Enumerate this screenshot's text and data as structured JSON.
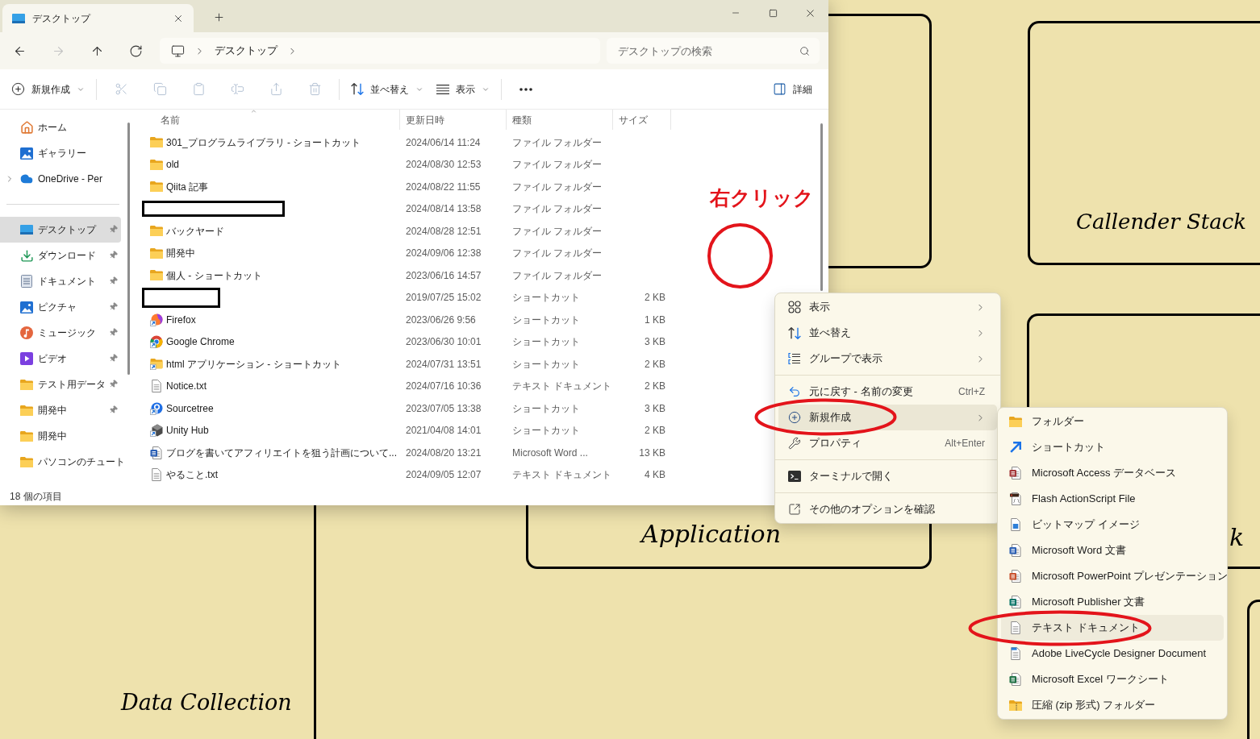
{
  "window": {
    "tab": {
      "title": "デスクトップ",
      "selected": true
    }
  },
  "navigation": {
    "buttons": [
      {
        "kind": "back",
        "disabled": false
      },
      {
        "kind": "forward",
        "disabled": true
      },
      {
        "kind": "up",
        "disabled": false
      },
      {
        "kind": "refresh",
        "disabled": false
      }
    ],
    "address": {
      "segments": [
        "デスクトップ"
      ]
    },
    "search": {
      "placeholder": "デスクトップの検索"
    }
  },
  "toolbar": {
    "groups": [
      {
        "items": [
          {
            "kind": "new",
            "label": "新規作成",
            "dropdown": true,
            "disabled": false
          }
        ]
      },
      {
        "items": [
          {
            "kind": "cut",
            "disabled": true
          },
          {
            "kind": "copy",
            "disabled": true
          },
          {
            "kind": "paste",
            "disabled": true
          },
          {
            "kind": "rename",
            "disabled": true
          },
          {
            "kind": "share",
            "disabled": true
          },
          {
            "kind": "delete",
            "disabled": true
          }
        ]
      },
      {
        "items": [
          {
            "kind": "sort",
            "label": "並べ替え",
            "dropdown": true,
            "disabled": false
          },
          {
            "kind": "view",
            "label": "表示",
            "dropdown": true,
            "disabled": false
          }
        ]
      },
      {
        "items": [
          {
            "kind": "more",
            "disabled": false
          }
        ]
      }
    ],
    "details": {
      "label": "詳細"
    }
  },
  "sidebar": {
    "items": [
      {
        "kind": "home",
        "label": "ホーム",
        "selected": false
      },
      {
        "kind": "gallery",
        "label": "ギャラリー",
        "selected": false
      },
      {
        "kind": "cloud",
        "label": "OneDrive - Per",
        "selected": false,
        "expanded": false
      }
    ],
    "quick_access": [
      {
        "kind": "desktop",
        "label": "デスクトップ",
        "selected": true,
        "pinned": true
      },
      {
        "kind": "download",
        "label": "ダウンロード",
        "selected": false,
        "pinned": true
      },
      {
        "kind": "documents",
        "label": "ドキュメント",
        "selected": false,
        "pinned": true
      },
      {
        "kind": "pictures",
        "label": "ピクチャ",
        "selected": false,
        "pinned": true
      },
      {
        "kind": "music",
        "label": "ミュージック",
        "selected": false,
        "pinned": true
      },
      {
        "kind": "video",
        "label": "ビデオ",
        "selected": false,
        "pinned": true
      },
      {
        "kind": "folder",
        "label": "テスト用データ",
        "selected": false,
        "pinned": true
      },
      {
        "kind": "folder",
        "label": "開発中",
        "selected": false,
        "pinned": true
      },
      {
        "kind": "folder",
        "label": "開発中",
        "selected": false,
        "pinned": false
      },
      {
        "kind": "folder",
        "label": "パソコンのチュート",
        "selected": false,
        "pinned": false
      }
    ]
  },
  "file_list": {
    "columns": [
      {
        "label": "名前",
        "sorted": true
      },
      {
        "label": "更新日時",
        "sorted": false
      },
      {
        "label": "種類",
        "sorted": false
      },
      {
        "label": "サイズ",
        "sorted": false
      }
    ],
    "rows": [
      {
        "kind": "folder",
        "name": "301_プログラムライブラリ - ショートカット",
        "modified": "2024/06/14 11:24",
        "type": "ファイル フォルダー"
      },
      {
        "kind": "folder",
        "name": "old",
        "modified": "2024/08/30 12:53",
        "type": "ファイル フォルダー"
      },
      {
        "kind": "folder",
        "name": "Qiita 記事",
        "modified": "2024/08/22 11:55",
        "type": "ファイル フォルダー"
      },
      {
        "kind": "redacted",
        "modified": "2024/08/14 13:58",
        "type": "ファイル フォルダー"
      },
      {
        "kind": "folder",
        "name": "バックヤード",
        "modified": "2024/08/28 12:51",
        "type": "ファイル フォルダー"
      },
      {
        "kind": "folder",
        "name": "開発中",
        "modified": "2024/09/06 12:38",
        "type": "ファイル フォルダー"
      },
      {
        "kind": "folder",
        "name": "個人 - ショートカット",
        "modified": "2023/06/16 14:57",
        "type": "ファイル フォルダー"
      },
      {
        "kind": "redacted",
        "modified": "2019/07/25 15:02",
        "type": "ショートカット",
        "size": "2 KB"
      },
      {
        "kind": "fox-app",
        "name": "Firefox",
        "modified": "2023/06/26 9:56",
        "type": "ショートカット",
        "size": "1 KB"
      },
      {
        "kind": "ring-app",
        "name": "Google Chrome",
        "modified": "2023/06/30 10:01",
        "type": "ショートカット",
        "size": "3 KB"
      },
      {
        "kind": "folder-shortcut",
        "name": "html アプリケーション - ショートカット",
        "modified": "2024/07/31 13:51",
        "type": "ショートカット",
        "size": "2 KB"
      },
      {
        "kind": "text-doc",
        "name": "Notice.txt",
        "modified": "2024/07/16 10:36",
        "type": "テキスト ドキュメント",
        "size": "2 KB"
      },
      {
        "kind": "swirl-app",
        "name": "Sourcetree",
        "modified": "2023/07/05 13:38",
        "type": "ショートカット",
        "size": "3 KB"
      },
      {
        "kind": "cube-app",
        "name": "Unity Hub",
        "modified": "2021/04/08 14:01",
        "type": "ショートカット",
        "size": "2 KB"
      },
      {
        "kind": "word-doc",
        "name": "ブログを書いてアフィリエイトを狙う計画について...",
        "modified": "2024/08/20 13:21",
        "type": "Microsoft Word ...",
        "size": "13 KB"
      },
      {
        "kind": "text-doc",
        "name": "やること.txt",
        "modified": "2024/09/05 12:07",
        "type": "テキスト ドキュメント",
        "size": "4 KB"
      }
    ]
  },
  "status_bar": {
    "text": "18 個の項目"
  },
  "click_annotation": {
    "label": "右クリック"
  },
  "context_menu": {
    "sections": [
      {
        "items": [
          {
            "kind": "view",
            "label": "表示",
            "submenu": true,
            "selected": false,
            "circled": false
          },
          {
            "kind": "sort",
            "label": "並べ替え",
            "submenu": true,
            "selected": false,
            "circled": false
          },
          {
            "kind": "group",
            "label": "グループで表示",
            "submenu": true,
            "selected": false,
            "circled": false
          }
        ]
      },
      {
        "items": [
          {
            "kind": "undo",
            "label": "元に戻す - 名前の変更",
            "shortcut": "Ctrl+Z",
            "submenu": false,
            "selected": false,
            "circled": false
          },
          {
            "kind": "new",
            "label": "新規作成",
            "submenu": true,
            "selected": true,
            "circled": true
          },
          {
            "kind": "properties",
            "label": "プロパティ",
            "shortcut": "Alt+Enter",
            "submenu": false,
            "selected": false,
            "circled": false
          }
        ]
      },
      {
        "items": [
          {
            "kind": "terminal",
            "label": "ターミナルで開く",
            "submenu": false,
            "selected": false,
            "circled": false
          }
        ]
      },
      {
        "items": [
          {
            "kind": "more-options",
            "label": "その他のオプションを確認",
            "submenu": false,
            "selected": false,
            "circled": false
          }
        ]
      }
    ]
  },
  "submenu": {
    "items": [
      {
        "kind": "folder",
        "label": "フォルダー",
        "selected": false,
        "circled": false
      },
      {
        "kind": "shortcut",
        "label": "ショートカット",
        "selected": false,
        "circled": false
      },
      {
        "kind": "db-doc",
        "label": "Microsoft Access データベース",
        "selected": false,
        "circled": false
      },
      {
        "kind": "script-doc",
        "label": "Flash ActionScript File",
        "selected": false,
        "circled": false
      },
      {
        "kind": "image-doc",
        "label": "ビットマップ イメージ",
        "selected": false,
        "circled": false
      },
      {
        "kind": "word-doc",
        "label": "Microsoft Word 文書",
        "selected": false,
        "circled": false
      },
      {
        "kind": "slides-doc",
        "label": "Microsoft PowerPoint プレゼンテーション",
        "selected": false,
        "circled": false
      },
      {
        "kind": "publish-doc",
        "label": "Microsoft Publisher 文書",
        "selected": false,
        "circled": false
      },
      {
        "kind": "text-doc",
        "label": "テキスト ドキュメント",
        "selected": true,
        "circled": true
      },
      {
        "kind": "form-doc",
        "label": "Adobe LiveCycle Designer Document",
        "selected": false,
        "circled": false
      },
      {
        "kind": "sheet-doc",
        "label": "Microsoft Excel ワークシート",
        "selected": false,
        "circled": false
      },
      {
        "kind": "zip-folder",
        "label": "圧縮 (zip 形式) フォルダー",
        "selected": false,
        "circled": false
      }
    ]
  },
  "desktop": {
    "cards": [
      {
        "title": "Callender Stack"
      },
      {
        "title": "Application"
      },
      {
        "title": "Data Collection"
      },
      {
        "title": "k"
      }
    ]
  }
}
